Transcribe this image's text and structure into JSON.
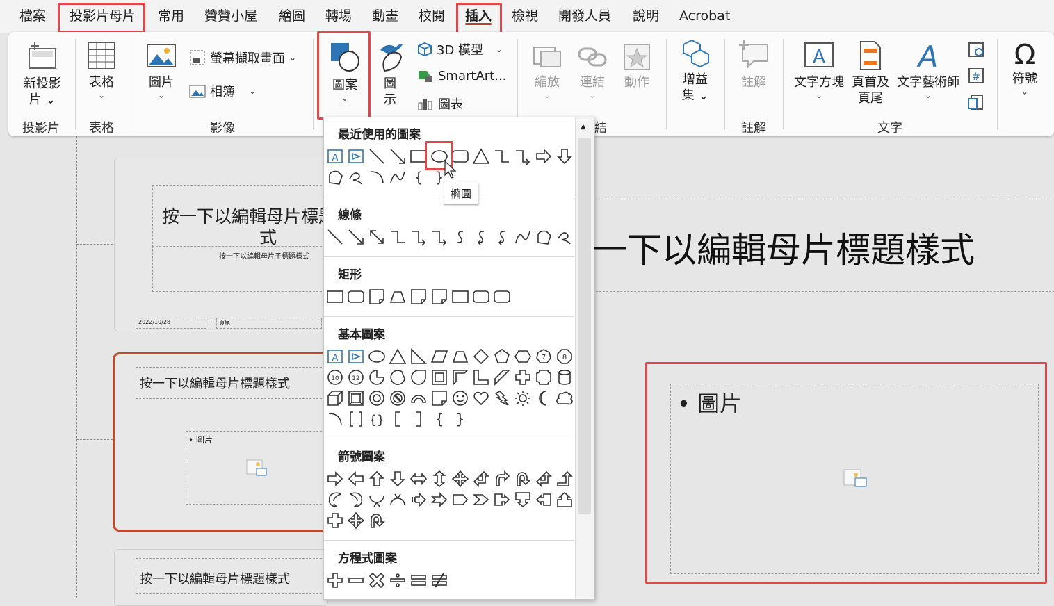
{
  "tabs": [
    "檔案",
    "投影片母片",
    "常用",
    "贊贊小屋",
    "繪圖",
    "轉場",
    "動畫",
    "校閱",
    "插入",
    "檢視",
    "開發人員",
    "說明",
    "Acrobat"
  ],
  "ribbon": {
    "new_slide": "新投影",
    "new_slide_2": "片",
    "table": "表格",
    "picture": "圖片",
    "screenshot": "螢幕擷取畫面",
    "album": "相簿",
    "shapes": "圖案",
    "icons": "圖",
    "icons_2": "示",
    "model3d": "3D 模型",
    "smartart": "SmartArt...",
    "chart": "圖表",
    "zoom": "縮放",
    "link": "連結",
    "action": "動作",
    "addins": "增益",
    "addins_2": "集",
    "comment": "註解",
    "textbox": "文字方塊",
    "header_footer": "頁首及",
    "header_footer_2": "頁尾",
    "wordart": "文字藝術師",
    "symbols": "符號"
  },
  "groups": {
    "slides": "投影片",
    "tables": "表格",
    "images": "影像",
    "links_tail": "結",
    "comments": "註解",
    "text": "文字"
  },
  "gallery": {
    "recent": "最近使用的圖案",
    "lines": "線條",
    "rectangles": "矩形",
    "basic": "基本圖案",
    "arrows": "箭號圖案",
    "equation": "方程式圖案",
    "tooltip": "橢圓"
  },
  "thumbs": {
    "t1_title": "按一下以編輯母片標題樣",
    "t1_title_2": "式",
    "t1_sub": "按一下以編輯母片子標題樣式",
    "t1_date": "2022/10/28",
    "t1_page": "頁尾",
    "t2_title": "按一下以編輯母片標題樣式",
    "t2_bullet": "• 圖片",
    "t3_title": "按一下以編輯母片標題樣式"
  },
  "main": {
    "title": "一下以編輯母片標題樣式",
    "bullet": "圖片"
  },
  "colors": {
    "highlight": "#e0484e",
    "accent": "#b7472a",
    "selected_thumb": "#c0492b",
    "icon_blue": "#2e75b6"
  }
}
